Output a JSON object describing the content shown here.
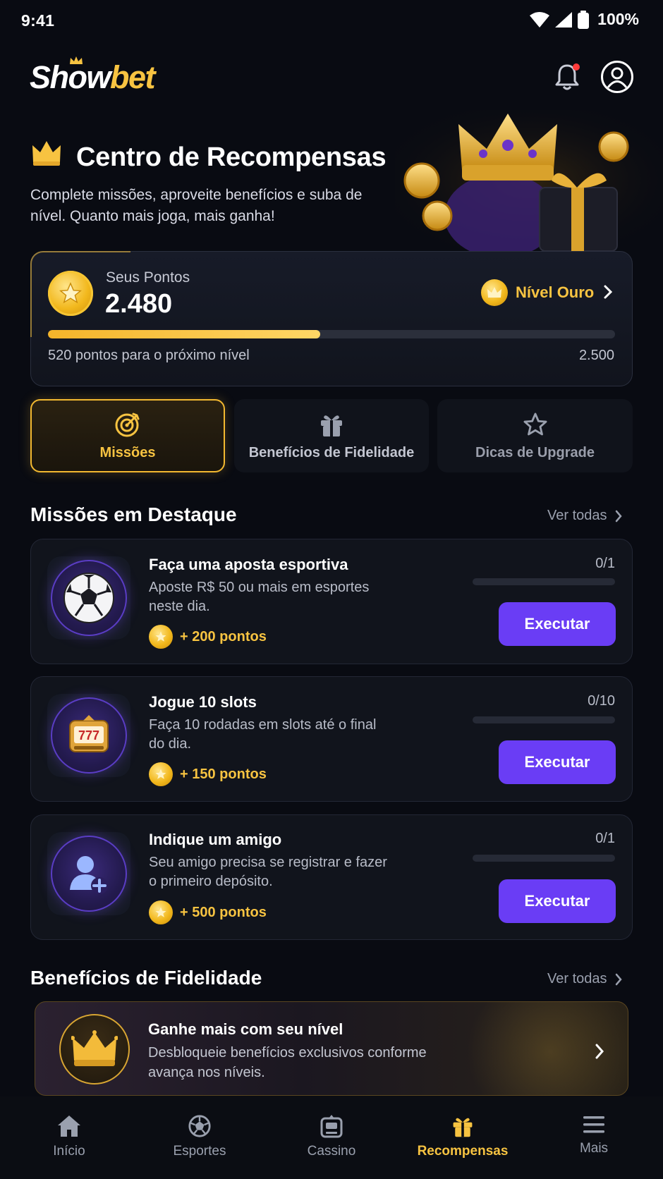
{
  "status_bar": {
    "time": "9:41",
    "battery": "100%"
  },
  "header": {
    "logo_show": "Show",
    "logo_bet": "bet"
  },
  "hero": {
    "title": "Centro de Recompensas",
    "subtitle": "Complete missões, aproveite benefícios e suba de nível. Quanto mais joga, mais ganha!"
  },
  "points": {
    "label": "Seus Pontos",
    "value": "2.480",
    "level": "Nível Ouro",
    "progress_fraction": 0.48,
    "hint": "520 pontos para o próximo nível",
    "goal": "2.500"
  },
  "tabs": [
    {
      "label": "Missões",
      "icon": "target-icon",
      "active": true
    },
    {
      "label": "Benefícios de Fidelidade",
      "icon": "gift-icon",
      "active": false
    },
    {
      "label": "Dicas de Upgrade",
      "icon": "star-icon",
      "active": false
    }
  ],
  "missions_section": {
    "title": "Missões em Destaque",
    "see_all": "Ver todas"
  },
  "missions": [
    {
      "title": "Faça uma aposta esportiva",
      "description": "Aposte R$ 50 ou mais em esportes neste dia.",
      "reward": "+ 200 pontos",
      "count": "0/1",
      "progress": 0,
      "button": "Executar",
      "icon": "soccer-ball-icon"
    },
    {
      "title": "Jogue 10 slots",
      "description": "Faça 10 rodadas em slots até o final do dia.",
      "reward": "+ 150 pontos",
      "count": "0/10",
      "progress": 0,
      "button": "Executar",
      "icon": "slot-machine-icon"
    },
    {
      "title": "Indique um amigo",
      "description": "Seu amigo precisa se registrar e fazer o primeiro depósito.",
      "reward": "+ 500 pontos",
      "count": "0/1",
      "progress": 0,
      "button": "Executar",
      "icon": "add-user-icon"
    }
  ],
  "benefits_section": {
    "title": "Benefícios de Fidelidade",
    "see_all": "Ver todas"
  },
  "benefit_card": {
    "title": "Ganhe mais com seu nível",
    "description": "Desbloqueie benefícios exclusivos conforme avança nos níveis."
  },
  "bottom_nav": [
    {
      "label": "Início",
      "icon": "home-icon",
      "active": false
    },
    {
      "label": "Esportes",
      "icon": "ball-icon",
      "active": false
    },
    {
      "label": "Cassino",
      "icon": "casino-icon",
      "active": false
    },
    {
      "label": "Recompensas",
      "icon": "gift-icon",
      "active": true
    },
    {
      "label": "Mais",
      "icon": "menu-icon",
      "active": false
    }
  ],
  "colors": {
    "accent_gold": "#f7c341",
    "button_purple": "#6a3df5",
    "background": "#090b12",
    "notification_dot": "#ff3b3b"
  }
}
